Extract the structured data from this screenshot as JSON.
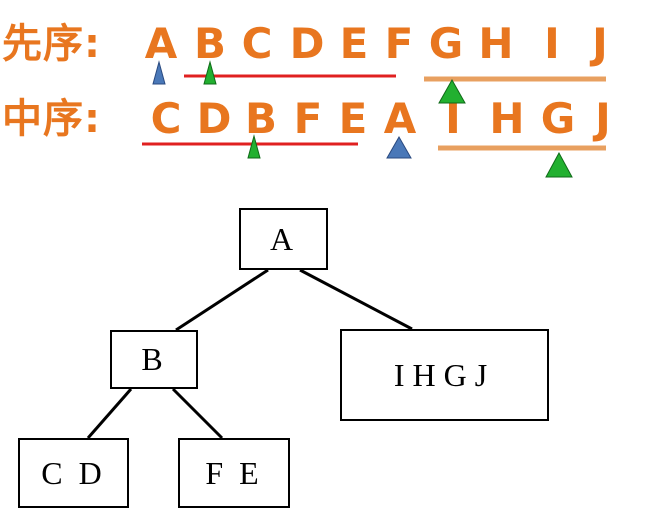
{
  "preorder": {
    "label": "先序:",
    "letters": [
      "A",
      "B",
      "C",
      "D",
      "E",
      "F",
      "G",
      "H",
      "I",
      "J"
    ]
  },
  "inorder": {
    "label": "中序:",
    "letters": [
      "C",
      "D",
      "B",
      "F",
      "E",
      "A",
      "I",
      "H",
      "G",
      "J"
    ]
  },
  "tree": {
    "root": "A",
    "left": "B",
    "right": "IHGJ",
    "left_left": "C D",
    "left_right": "F E"
  },
  "colors": {
    "orange": "#e8761f",
    "red_underline": "#e02020",
    "orange_underline": "#e8a060",
    "marker_blue": "#4a78b8",
    "marker_green": "#22b030"
  }
}
